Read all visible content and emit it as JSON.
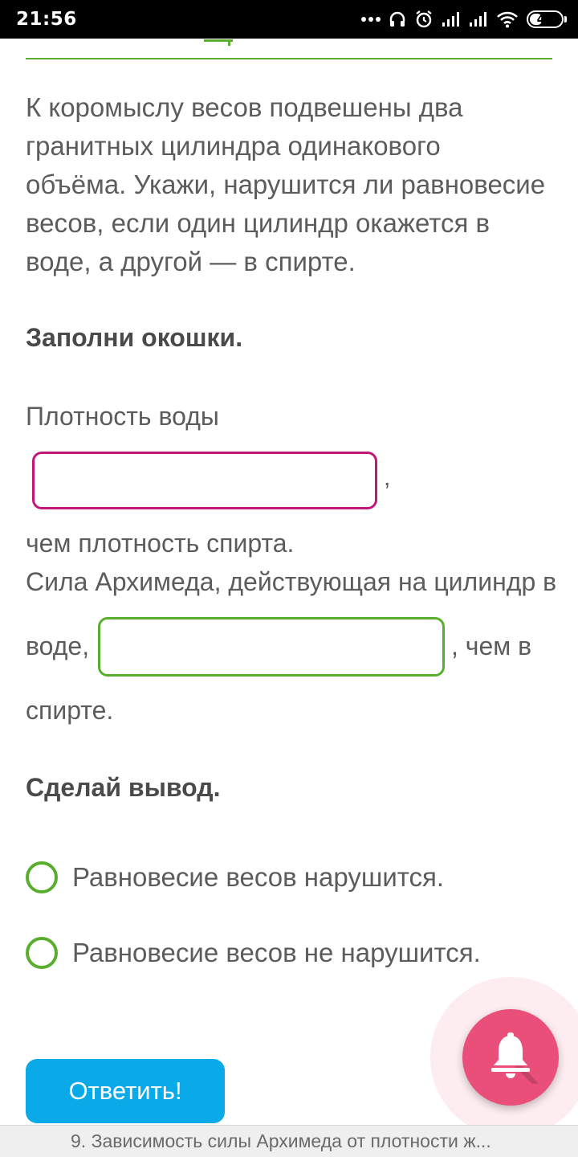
{
  "status_bar": {
    "time": "21:56",
    "battery_level": "41",
    "battery_fraction": 0.41,
    "icons": [
      "more-dots-icon",
      "headphones-icon",
      "alarm-icon",
      "signal-icon",
      "signal-icon",
      "wifi-icon",
      "battery-icon"
    ]
  },
  "question": {
    "text": "К коромыслу весов подвешены два гранитных цилиндра одинакового объёма. Укажи, нарушится ли равновесие весов, если один цилиндр окажется в воде, а другой — в спирте."
  },
  "fill_section": {
    "heading": "Заполни окошки.",
    "line1_prefix": "Плотность воды",
    "input1_value": "",
    "input1_comma": ",",
    "line1_suffix": "чем плотность спирта.",
    "line2_prefix": "Сила Архимеда, действующая на цилиндр в",
    "line2_word": "воде,",
    "input2_value": "",
    "line2_suffix": ", чем в",
    "line2_end": "спирте."
  },
  "conclusion": {
    "heading": "Сделай вывод.",
    "options": [
      {
        "label": "Равновесие весов нарушится."
      },
      {
        "label": "Равновесие весов не нарушится."
      }
    ]
  },
  "answer_button": {
    "label": "Ответить!"
  },
  "notification_fab": {
    "icon": "bell-icon"
  },
  "bottom_bar": {
    "title": "9. Зависимость силы Архимеда от плотности ж..."
  },
  "colors": {
    "accent_green": "#5aae2e",
    "input_magenta": "#c0187a",
    "button_blue": "#0aaae8",
    "fab_pink": "#e94f78"
  }
}
